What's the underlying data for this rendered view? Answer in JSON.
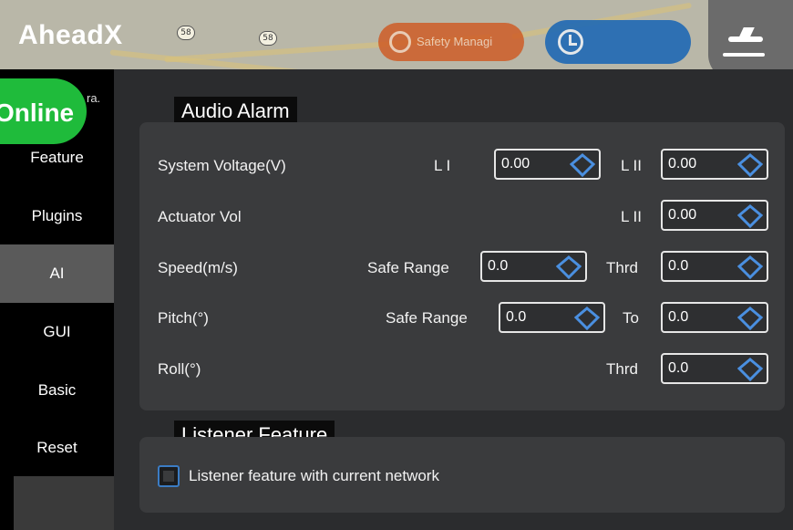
{
  "topbar": {
    "logo": "AheadX",
    "road_badges": [
      "58",
      "58"
    ],
    "safety_button_label": "Safety Managi",
    "colors": {
      "safety": "#cf5a23",
      "time": "#1f69b5",
      "online": "#1fbb3b"
    }
  },
  "status": {
    "online_label": "Online",
    "ra_text": "ra."
  },
  "sidebar": {
    "items": [
      {
        "label": "Feature"
      },
      {
        "label": "Plugins"
      },
      {
        "label": "AI",
        "active": true
      },
      {
        "label": "GUI"
      },
      {
        "label": "Basic"
      },
      {
        "label": "Reset"
      }
    ]
  },
  "audio_alarm": {
    "title": "Audio Alarm",
    "rows": {
      "system_voltage": {
        "label": "System Voltage(V)",
        "l1_label": "L I",
        "l1_value": "0.00",
        "l2_label": "L II",
        "l2_value": "0.00"
      },
      "actuator_vol": {
        "label": "Actuator Vol",
        "l2_label": "L II",
        "l2_value": "0.00"
      },
      "speed": {
        "label": "Speed(m/s)",
        "safe_label": "Safe Range",
        "safe_value": "0.0",
        "thrd_label": "Thrd",
        "thrd_value": "0.0"
      },
      "pitch": {
        "label": "Pitch(°)",
        "safe_label": "Safe Range",
        "safe_value": "0.0",
        "to_label": "To",
        "to_value": "0.0"
      },
      "roll": {
        "label": "Roll(°)",
        "thrd_label": "Thrd",
        "thrd_value": "0.0"
      }
    }
  },
  "listener": {
    "title": "Listener Feature",
    "checkbox_label": "Listener feature with current network",
    "checked": false
  }
}
